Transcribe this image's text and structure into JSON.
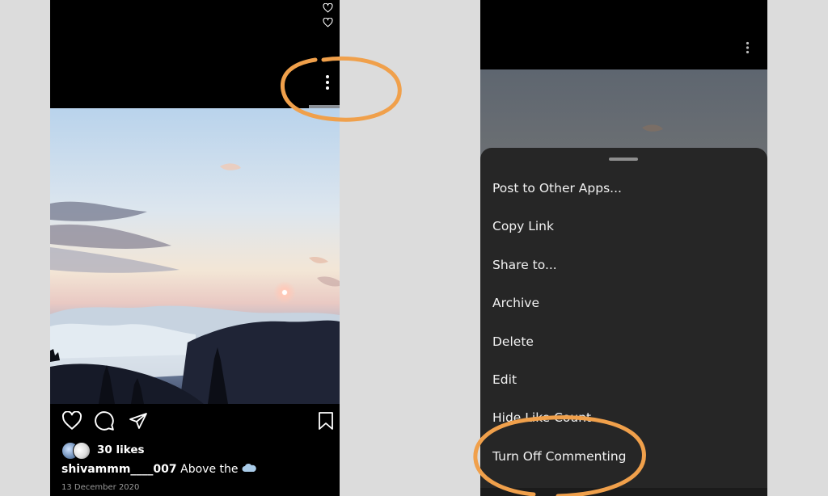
{
  "left_post": {
    "likes_text": "30 likes",
    "caption_user": "shivammm____007",
    "caption_text": "Above the",
    "date": "13 December 2020"
  },
  "menu": {
    "items": [
      "Post to Other Apps...",
      "Copy Link",
      "Share to...",
      "Archive",
      "Delete",
      "Edit",
      "Hide Like Count",
      "Turn Off Commenting"
    ]
  },
  "icons": {
    "top_right": [
      "heart-outline-icon",
      "heart-outline-icon"
    ],
    "header": "more-vertical-icon",
    "actions": [
      "heart-icon",
      "comment-icon",
      "send-icon",
      "bookmark-icon"
    ],
    "caption_emoji": "cloud-icon"
  },
  "colors": {
    "background": "#dcdcdc",
    "phone": "#000000",
    "sheet": "#262626",
    "annotation": "#f0a04b",
    "menu_text": "#f2f2f2",
    "date_text": "#9a9a9a"
  }
}
